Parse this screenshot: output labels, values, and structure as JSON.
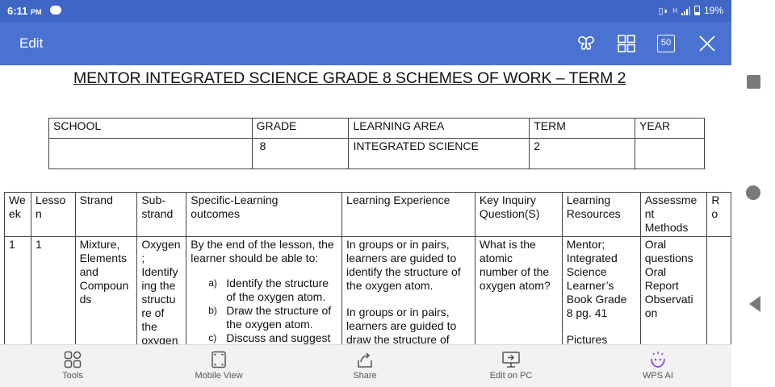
{
  "status_bar": {
    "time": "6:11",
    "time_suffix": "PM",
    "signal_label": "H",
    "battery": "19%"
  },
  "toolbar": {
    "edit_label": "Edit",
    "page_badge": "50",
    "icons": [
      "butterfly-icon",
      "grid-icon",
      "page-count-icon",
      "close-icon"
    ]
  },
  "document": {
    "title": "MENTOR INTEGRATED SCIENCE GRADE 8 SCHEMES OF WORK – TERM 2",
    "info_table": {
      "headers": [
        "SCHOOL",
        "GRADE",
        "LEARNING AREA",
        "TERM",
        "YEAR"
      ],
      "values": [
        "",
        "8",
        "INTEGRATED SCIENCE",
        "2",
        ""
      ]
    },
    "scheme_table": {
      "headers": {
        "week": [
          "We",
          "ek"
        ],
        "lesson": [
          "Lesso",
          "n"
        ],
        "strand": "Strand",
        "sub_strand": [
          "Sub-",
          "strand"
        ],
        "outcomes": [
          "Specific-Learning",
          "outcomes"
        ],
        "experience": "Learning Experience",
        "inquiry": [
          "Key Inquiry",
          "Question(S)"
        ],
        "resources": [
          "Learning",
          "Resources"
        ],
        "assessment": [
          "Assessme",
          "nt",
          "Methods"
        ],
        "reflection": [
          "R",
          "o"
        ]
      },
      "row": {
        "week": "1",
        "lesson": "1",
        "strand": [
          "Mixture,",
          "Elements",
          "and",
          "Compoun",
          "ds"
        ],
        "sub_strand": [
          "Oxygen",
          ";",
          "Identify",
          "ing the",
          "structu",
          "re of",
          "the",
          "oxygen"
        ],
        "outcomes_intro": [
          "By the end of the lesson, the",
          "learner should be able to:"
        ],
        "outcomes": [
          {
            "letter": "a)",
            "lines": [
              "Identify the structure",
              "of the oxygen atom."
            ]
          },
          {
            "letter": "b)",
            "lines": [
              "Draw the structure of",
              "the oxygen atom."
            ]
          },
          {
            "letter": "c)",
            "lines": [
              "Discuss and suggest"
            ]
          }
        ],
        "experience_1": [
          "In groups or in pairs,",
          "learners are guided to",
          "identify the structure of",
          "the oxygen atom."
        ],
        "experience_2": [
          "In groups or in pairs,",
          "learners are guided to",
          "draw the structure of"
        ],
        "inquiry": [
          "What is the",
          "atomic",
          "number of the",
          "oxygen atom?"
        ],
        "resources": [
          "Mentor;",
          "Integrated",
          "Science",
          "Learner’s",
          "Book Grade",
          "8 pg. 41"
        ],
        "resources_2": "Pictures",
        "assessment": [
          "Oral",
          "questions",
          "Oral",
          "Report",
          "Observati",
          "on"
        ]
      }
    }
  },
  "bottom_nav": [
    {
      "label": "Tools",
      "icon": "tools-icon"
    },
    {
      "label": "Mobile View",
      "icon": "mobile-view-icon"
    },
    {
      "label": "Share",
      "icon": "share-icon"
    },
    {
      "label": "Edit on PC",
      "icon": "edit-on-pc-icon"
    },
    {
      "label": "WPS AI",
      "icon": "wps-ai-icon"
    }
  ],
  "colors": {
    "status_bar": "#3f66c5",
    "toolbar": "#4a72d0",
    "ai_accent": "#8a4fe0",
    "system_nav": "#7a7a7a"
  }
}
